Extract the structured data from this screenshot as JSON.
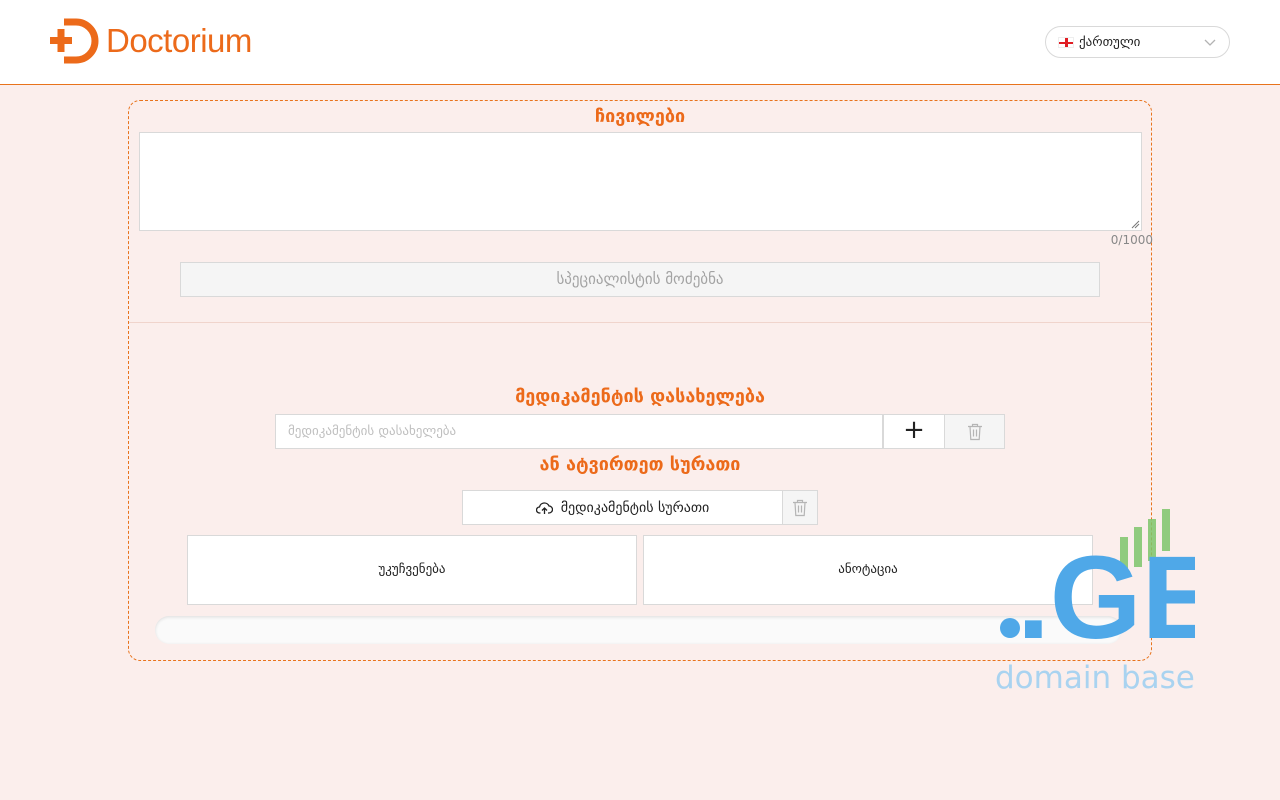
{
  "header": {
    "logo_text": "Doctorium",
    "language": {
      "selected": "ქართული",
      "flag_icon": "georgia-flag-icon"
    }
  },
  "notes": {
    "title": "ჩივილები",
    "value": "",
    "counter": "0/1000"
  },
  "specialist": {
    "search_label": "სპეციალისტის მოძებნა"
  },
  "medication": {
    "title": "მედიკამენტის დასახელება",
    "input_placeholder": "მედიკამენტის დასახელება",
    "add_label": "+",
    "or_upload_title": "ან ატვირთეთ სურათი",
    "upload_label": "მედიკამენტის სურათი"
  },
  "cards": {
    "contraindications": "უკუჩვენება",
    "annotation": "ანოტაცია"
  },
  "progress": {
    "value_percent": 0
  },
  "watermark": {
    "logo_text": ".GE",
    "subtitle": "domain base"
  },
  "colors": {
    "accent": "#ec6a1a",
    "background": "#fbeeec",
    "watermark_blue": "#4fa8e8",
    "watermark_green": "#7cc46b"
  }
}
